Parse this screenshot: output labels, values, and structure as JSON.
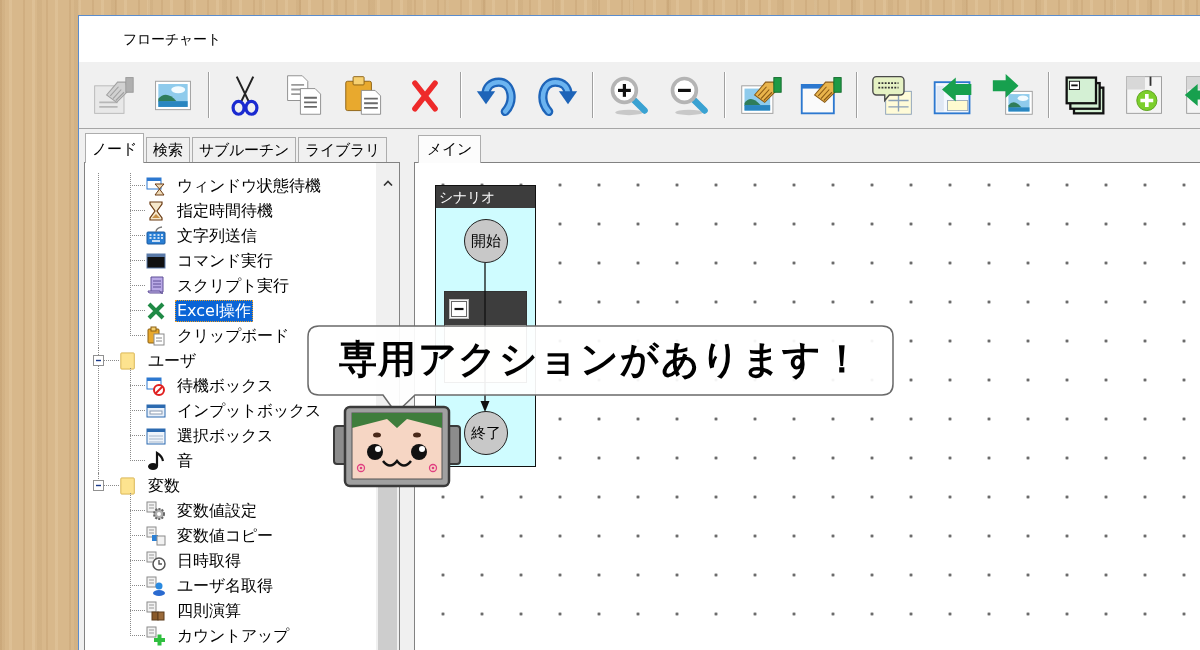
{
  "window": {
    "title": "フローチャート"
  },
  "toolbar": [
    {
      "buttons": [
        {
          "disabled": true
        },
        {
          "disabled": false
        }
      ]
    },
    {
      "buttons": [
        {
          "disabled": false
        },
        {
          "disabled": false
        },
        {
          "disabled": false
        },
        {
          "disabled": false
        }
      ]
    },
    {
      "buttons": [
        {
          "disabled": false
        },
        {
          "disabled": false
        }
      ]
    },
    {
      "buttons": [
        {
          "disabled": false
        },
        {
          "disabled": false
        }
      ]
    },
    {
      "buttons": [
        {
          "disabled": false
        },
        {
          "disabled": false
        }
      ]
    },
    {
      "buttons": [
        {
          "disabled": false
        },
        {
          "disabled": false
        },
        {
          "disabled": false
        }
      ]
    },
    {
      "buttons": [
        {
          "disabled": false
        },
        {
          "disabled": false
        },
        {
          "disabled": false
        }
      ]
    }
  ],
  "side_panel": {
    "tabs": [
      {
        "label": "ノード",
        "selected": true
      },
      {
        "label": "検索",
        "selected": false
      },
      {
        "label": "サブルーチン",
        "selected": false
      },
      {
        "label": "ライブラリ",
        "selected": false
      }
    ],
    "tree": {
      "continued_children": [
        {
          "label": "ウィンドウ状態待機",
          "selected": false
        },
        {
          "label": "指定時間待機",
          "selected": false
        },
        {
          "label": "文字列送信",
          "selected": false
        },
        {
          "label": "コマンド実行",
          "selected": false
        },
        {
          "label": "スクリプト実行",
          "selected": false
        },
        {
          "label": "Excel操作",
          "selected": true
        },
        {
          "label": "クリップボード",
          "selected": false
        }
      ],
      "folders": [
        {
          "label": "ユーザ",
          "selected": false,
          "expanded": true,
          "children": [
            {
              "label": "待機ボックス",
              "selected": false
            },
            {
              "label": "インプットボックス",
              "selected": false
            },
            {
              "label": "選択ボックス",
              "selected": false
            },
            {
              "label": "音",
              "selected": false
            }
          ]
        },
        {
          "label": "変数",
          "selected": false,
          "expanded": true,
          "children": [
            {
              "label": "変数値設定",
              "selected": false
            },
            {
              "label": "変数値コピー",
              "selected": false
            },
            {
              "label": "日時取得",
              "selected": false
            },
            {
              "label": "ユーザ名取得",
              "selected": false
            },
            {
              "label": "四則演算",
              "selected": false
            },
            {
              "label": "カウントアップ",
              "selected": false
            }
          ]
        }
      ]
    }
  },
  "editor": {
    "tabs": [
      {
        "label": "メイン",
        "selected": true
      }
    ],
    "lane": {
      "title": "シナリオ",
      "nodes": [
        {
          "kind": "terminal",
          "label": "開始"
        },
        {
          "kind": "group",
          "expanded": true
        },
        {
          "kind": "terminal",
          "label": "終了"
        }
      ]
    }
  },
  "callout": {
    "text": "専用アクションがあります！"
  }
}
